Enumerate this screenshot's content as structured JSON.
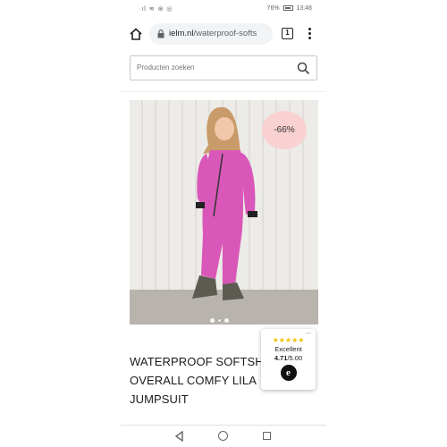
{
  "status_bar": {
    "left_icons": "·ıl ≋ ⊛ ◎",
    "battery": "76%",
    "time": "13:46"
  },
  "browser": {
    "url_domain": "ielm.nl",
    "url_path": "/waterproof-softs",
    "tab_count": "1"
  },
  "search": {
    "placeholder": "Producten zoeken"
  },
  "product": {
    "discount_badge": "-66%",
    "title_lines": [
      "WATERPROOF SOFTSHELL",
      "OVERALL COMFY LILA",
      "JUMPSUIT"
    ],
    "image_slide_count": 3,
    "image_active_index": 1
  },
  "trust_badge": {
    "more": "...",
    "stars": "★★★★★",
    "label": "Excellent",
    "score": "4.71",
    "score_max": "/5.00",
    "logo": "e"
  },
  "colors": {
    "badge_bg": "#f9d1d1",
    "suit_pink": "#d957b9",
    "star_yellow": "#f0c000"
  }
}
